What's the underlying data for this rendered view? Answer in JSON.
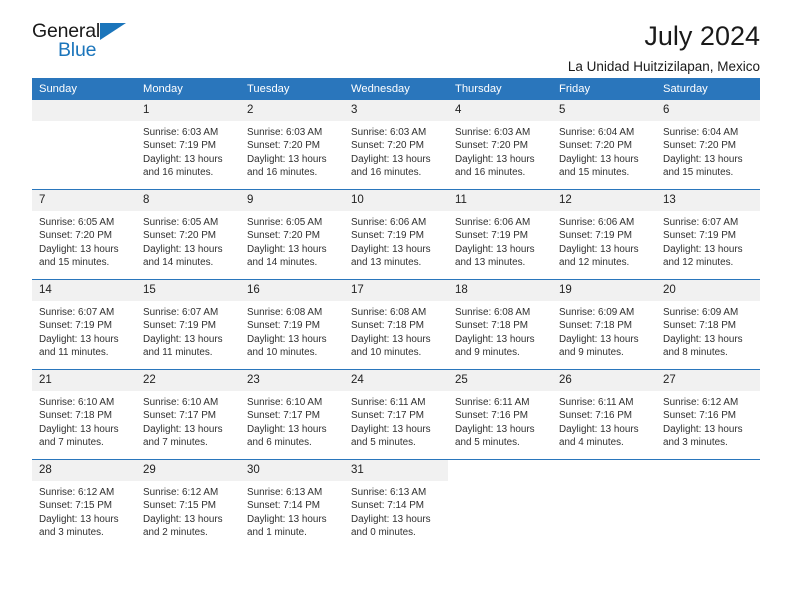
{
  "brand": {
    "name_part1": "General",
    "name_part2": "Blue",
    "accent_color": "#1b75bb"
  },
  "header": {
    "title": "July 2024",
    "subtitle": "La Unidad Huitzizilapan, Mexico"
  },
  "calendar": {
    "header_bg": "#2a76bc",
    "daynum_bg": "#f1f1f1",
    "weekday_headers": [
      "Sunday",
      "Monday",
      "Tuesday",
      "Wednesday",
      "Thursday",
      "Friday",
      "Saturday"
    ],
    "weeks": [
      [
        {
          "day": "",
          "sunrise": "",
          "sunset": "",
          "daylight_line1": "",
          "daylight_line2": "",
          "empty": true
        },
        {
          "day": "1",
          "sunrise": "Sunrise: 6:03 AM",
          "sunset": "Sunset: 7:19 PM",
          "daylight_line1": "Daylight: 13 hours",
          "daylight_line2": "and 16 minutes."
        },
        {
          "day": "2",
          "sunrise": "Sunrise: 6:03 AM",
          "sunset": "Sunset: 7:20 PM",
          "daylight_line1": "Daylight: 13 hours",
          "daylight_line2": "and 16 minutes."
        },
        {
          "day": "3",
          "sunrise": "Sunrise: 6:03 AM",
          "sunset": "Sunset: 7:20 PM",
          "daylight_line1": "Daylight: 13 hours",
          "daylight_line2": "and 16 minutes."
        },
        {
          "day": "4",
          "sunrise": "Sunrise: 6:03 AM",
          "sunset": "Sunset: 7:20 PM",
          "daylight_line1": "Daylight: 13 hours",
          "daylight_line2": "and 16 minutes."
        },
        {
          "day": "5",
          "sunrise": "Sunrise: 6:04 AM",
          "sunset": "Sunset: 7:20 PM",
          "daylight_line1": "Daylight: 13 hours",
          "daylight_line2": "and 15 minutes."
        },
        {
          "day": "6",
          "sunrise": "Sunrise: 6:04 AM",
          "sunset": "Sunset: 7:20 PM",
          "daylight_line1": "Daylight: 13 hours",
          "daylight_line2": "and 15 minutes."
        }
      ],
      [
        {
          "day": "7",
          "sunrise": "Sunrise: 6:05 AM",
          "sunset": "Sunset: 7:20 PM",
          "daylight_line1": "Daylight: 13 hours",
          "daylight_line2": "and 15 minutes."
        },
        {
          "day": "8",
          "sunrise": "Sunrise: 6:05 AM",
          "sunset": "Sunset: 7:20 PM",
          "daylight_line1": "Daylight: 13 hours",
          "daylight_line2": "and 14 minutes."
        },
        {
          "day": "9",
          "sunrise": "Sunrise: 6:05 AM",
          "sunset": "Sunset: 7:20 PM",
          "daylight_line1": "Daylight: 13 hours",
          "daylight_line2": "and 14 minutes."
        },
        {
          "day": "10",
          "sunrise": "Sunrise: 6:06 AM",
          "sunset": "Sunset: 7:19 PM",
          "daylight_line1": "Daylight: 13 hours",
          "daylight_line2": "and 13 minutes."
        },
        {
          "day": "11",
          "sunrise": "Sunrise: 6:06 AM",
          "sunset": "Sunset: 7:19 PM",
          "daylight_line1": "Daylight: 13 hours",
          "daylight_line2": "and 13 minutes."
        },
        {
          "day": "12",
          "sunrise": "Sunrise: 6:06 AM",
          "sunset": "Sunset: 7:19 PM",
          "daylight_line1": "Daylight: 13 hours",
          "daylight_line2": "and 12 minutes."
        },
        {
          "day": "13",
          "sunrise": "Sunrise: 6:07 AM",
          "sunset": "Sunset: 7:19 PM",
          "daylight_line1": "Daylight: 13 hours",
          "daylight_line2": "and 12 minutes."
        }
      ],
      [
        {
          "day": "14",
          "sunrise": "Sunrise: 6:07 AM",
          "sunset": "Sunset: 7:19 PM",
          "daylight_line1": "Daylight: 13 hours",
          "daylight_line2": "and 11 minutes."
        },
        {
          "day": "15",
          "sunrise": "Sunrise: 6:07 AM",
          "sunset": "Sunset: 7:19 PM",
          "daylight_line1": "Daylight: 13 hours",
          "daylight_line2": "and 11 minutes."
        },
        {
          "day": "16",
          "sunrise": "Sunrise: 6:08 AM",
          "sunset": "Sunset: 7:19 PM",
          "daylight_line1": "Daylight: 13 hours",
          "daylight_line2": "and 10 minutes."
        },
        {
          "day": "17",
          "sunrise": "Sunrise: 6:08 AM",
          "sunset": "Sunset: 7:18 PM",
          "daylight_line1": "Daylight: 13 hours",
          "daylight_line2": "and 10 minutes."
        },
        {
          "day": "18",
          "sunrise": "Sunrise: 6:08 AM",
          "sunset": "Sunset: 7:18 PM",
          "daylight_line1": "Daylight: 13 hours",
          "daylight_line2": "and 9 minutes."
        },
        {
          "day": "19",
          "sunrise": "Sunrise: 6:09 AM",
          "sunset": "Sunset: 7:18 PM",
          "daylight_line1": "Daylight: 13 hours",
          "daylight_line2": "and 9 minutes."
        },
        {
          "day": "20",
          "sunrise": "Sunrise: 6:09 AM",
          "sunset": "Sunset: 7:18 PM",
          "daylight_line1": "Daylight: 13 hours",
          "daylight_line2": "and 8 minutes."
        }
      ],
      [
        {
          "day": "21",
          "sunrise": "Sunrise: 6:10 AM",
          "sunset": "Sunset: 7:18 PM",
          "daylight_line1": "Daylight: 13 hours",
          "daylight_line2": "and 7 minutes."
        },
        {
          "day": "22",
          "sunrise": "Sunrise: 6:10 AM",
          "sunset": "Sunset: 7:17 PM",
          "daylight_line1": "Daylight: 13 hours",
          "daylight_line2": "and 7 minutes."
        },
        {
          "day": "23",
          "sunrise": "Sunrise: 6:10 AM",
          "sunset": "Sunset: 7:17 PM",
          "daylight_line1": "Daylight: 13 hours",
          "daylight_line2": "and 6 minutes."
        },
        {
          "day": "24",
          "sunrise": "Sunrise: 6:11 AM",
          "sunset": "Sunset: 7:17 PM",
          "daylight_line1": "Daylight: 13 hours",
          "daylight_line2": "and 5 minutes."
        },
        {
          "day": "25",
          "sunrise": "Sunrise: 6:11 AM",
          "sunset": "Sunset: 7:16 PM",
          "daylight_line1": "Daylight: 13 hours",
          "daylight_line2": "and 5 minutes."
        },
        {
          "day": "26",
          "sunrise": "Sunrise: 6:11 AM",
          "sunset": "Sunset: 7:16 PM",
          "daylight_line1": "Daylight: 13 hours",
          "daylight_line2": "and 4 minutes."
        },
        {
          "day": "27",
          "sunrise": "Sunrise: 6:12 AM",
          "sunset": "Sunset: 7:16 PM",
          "daylight_line1": "Daylight: 13 hours",
          "daylight_line2": "and 3 minutes."
        }
      ],
      [
        {
          "day": "28",
          "sunrise": "Sunrise: 6:12 AM",
          "sunset": "Sunset: 7:15 PM",
          "daylight_line1": "Daylight: 13 hours",
          "daylight_line2": "and 3 minutes."
        },
        {
          "day": "29",
          "sunrise": "Sunrise: 6:12 AM",
          "sunset": "Sunset: 7:15 PM",
          "daylight_line1": "Daylight: 13 hours",
          "daylight_line2": "and 2 minutes."
        },
        {
          "day": "30",
          "sunrise": "Sunrise: 6:13 AM",
          "sunset": "Sunset: 7:14 PM",
          "daylight_line1": "Daylight: 13 hours",
          "daylight_line2": "and 1 minute."
        },
        {
          "day": "31",
          "sunrise": "Sunrise: 6:13 AM",
          "sunset": "Sunset: 7:14 PM",
          "daylight_line1": "Daylight: 13 hours",
          "daylight_line2": "and 0 minutes."
        },
        {
          "day": "",
          "sunrise": "",
          "sunset": "",
          "daylight_line1": "",
          "daylight_line2": "",
          "empty": true,
          "blank": true
        },
        {
          "day": "",
          "sunrise": "",
          "sunset": "",
          "daylight_line1": "",
          "daylight_line2": "",
          "empty": true,
          "blank": true
        },
        {
          "day": "",
          "sunrise": "",
          "sunset": "",
          "daylight_line1": "",
          "daylight_line2": "",
          "empty": true,
          "blank": true
        }
      ]
    ]
  }
}
